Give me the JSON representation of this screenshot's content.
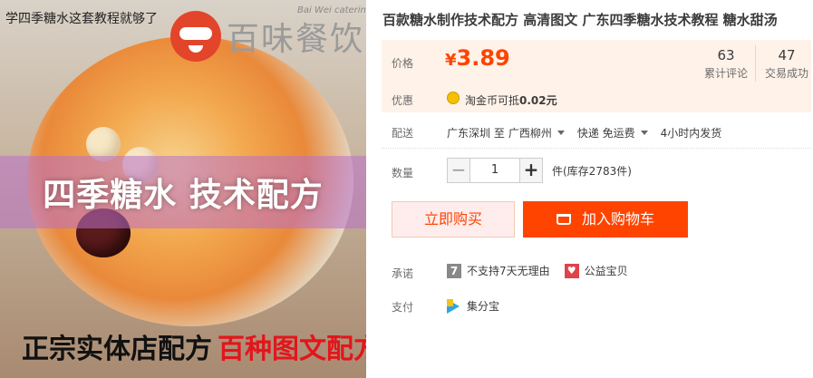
{
  "image": {
    "caption_top": "学四季糖水这套教程就够了",
    "logo_text": "百味餐饮",
    "logo_sub": "Bai Wei catering",
    "banner_text": "四季糖水 技术配方",
    "bottom_black": "正宗实体店配方",
    "bottom_red": "百种图文配方"
  },
  "product": {
    "title": "百款糖水制作技术配方 高清图文 广东四季糖水技术教程 糖水甜汤",
    "price_label": "价格",
    "currency": "¥",
    "price": "3.89",
    "reviews_count": "63",
    "reviews_label": "累计评论",
    "sales_count": "47",
    "sales_label": "交易成功",
    "promo_label": "优惠",
    "promo_text": "淘金币可抵",
    "promo_value": "0.02元",
    "ship_label": "配送",
    "ship_from": "广东深圳 至",
    "ship_to": "广西柳州",
    "ship_method": "快递 免运费",
    "ship_time": "4小时内发货",
    "qty_label": "数量",
    "qty_minus": "−",
    "qty_value": "1",
    "qty_plus": "+",
    "stock_text": "件(库存2783件)",
    "buy_now": "立即购买",
    "add_cart": "加入购物车",
    "promise_label": "承诺",
    "promise_7": "7",
    "promise_text": "不支持7天无理由",
    "charity_text": "公益宝贝",
    "pay_label": "支付",
    "pay_method": "集分宝"
  },
  "colors": {
    "accent": "#ff4400",
    "price_bg": "#fff2e8"
  }
}
